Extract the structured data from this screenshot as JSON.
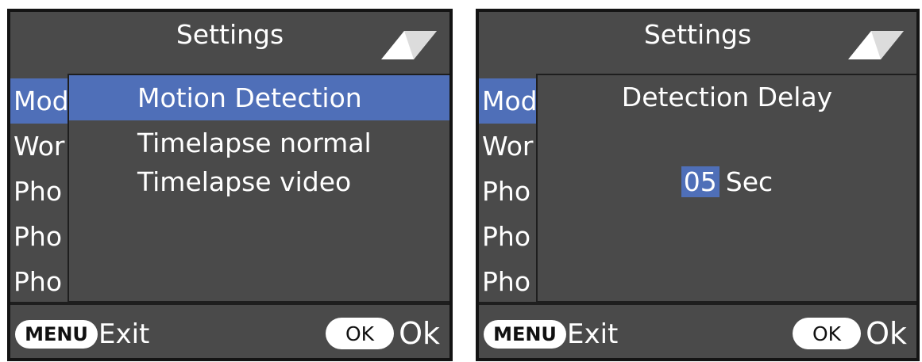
{
  "left_screen": {
    "title": "Settings",
    "menu_items": [
      "Mod",
      "Wor",
      "Pho",
      "Pho",
      "Pho"
    ],
    "popup_options": [
      "Motion Detection",
      "Timelapse normal",
      "Timelapse video"
    ],
    "selected_option": "Motion Detection",
    "footer": {
      "menu_key": "MENU",
      "exit_label": "Exit",
      "ok_key": "OK",
      "ok_label": "Ok"
    }
  },
  "right_screen": {
    "title": "Settings",
    "menu_items": [
      "Mod",
      "Wor",
      "Pho",
      "Pho",
      "Pho"
    ],
    "dialog_title": "Detection Delay",
    "value": "05",
    "unit": "Sec",
    "footer": {
      "menu_key": "MENU",
      "exit_label": "Exit",
      "ok_key": "OK",
      "ok_label": "Ok"
    }
  },
  "colors": {
    "highlight": "#4f6fb8",
    "panel": "#4a4a4a",
    "frame": "#141414"
  },
  "icons": [
    "scroll-indicator-icon"
  ]
}
